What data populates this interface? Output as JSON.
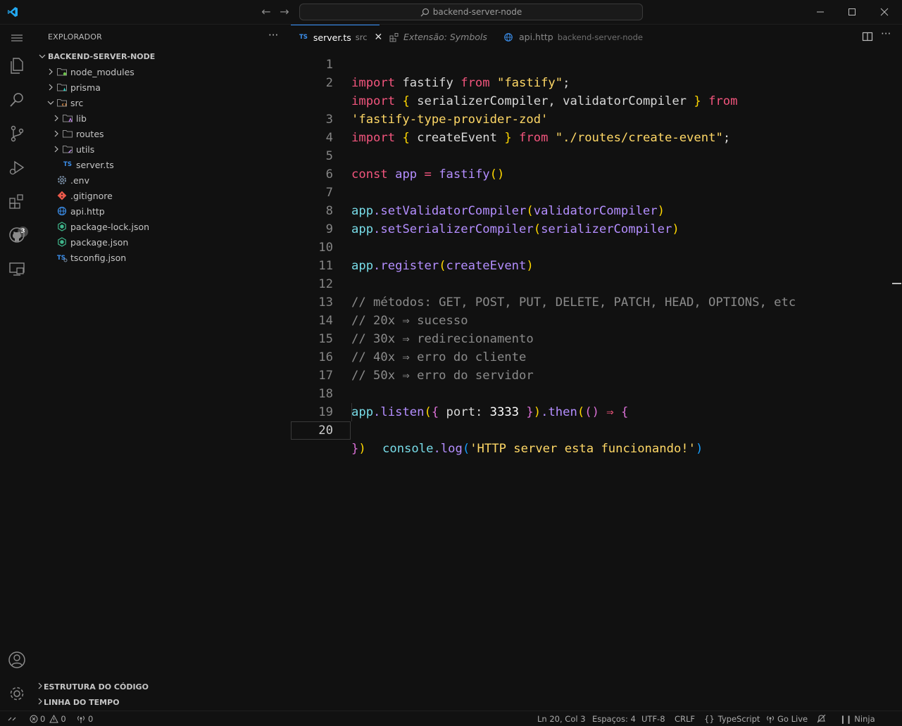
{
  "titlebar": {
    "search_text": "backend-server-node"
  },
  "activitybar": {
    "extensions_badge": "3"
  },
  "sidebar": {
    "title": "EXPLORADOR",
    "more": "···",
    "root": "BACKEND-SERVER-NODE",
    "items": [
      {
        "label": "node_modules"
      },
      {
        "label": "prisma"
      },
      {
        "label": "src"
      },
      {
        "label": "lib"
      },
      {
        "label": "routes"
      },
      {
        "label": "utils"
      },
      {
        "label": "server.ts"
      },
      {
        "label": ".env"
      },
      {
        "label": ".gitignore"
      },
      {
        "label": "api.http"
      },
      {
        "label": "package-lock.json"
      },
      {
        "label": "package.json"
      },
      {
        "label": "tsconfig.json"
      }
    ],
    "outline": "ESTRUTURA DO CÓDIGO",
    "timeline": "LINHA DO TEMPO"
  },
  "tabs": [
    {
      "badge": "TS",
      "label": "server.ts",
      "desc": "src",
      "close": "✕"
    },
    {
      "label": "Extensão: Symbols"
    },
    {
      "label": "api.http",
      "desc": "backend-server-node"
    }
  ],
  "code": {
    "line_numbers": [
      "1",
      "2",
      "",
      "3",
      "4",
      "5",
      "6",
      "7",
      "8",
      "9",
      "10",
      "11",
      "12",
      "13",
      "14",
      "15",
      "16",
      "17",
      "18",
      "19",
      "20"
    ],
    "l1": {
      "a": "import",
      "b": " fastify ",
      "c": "from",
      "d": " \"fastify\"",
      "e": ";"
    },
    "l2": {
      "a": "import",
      "b": "{",
      "c": " serializerCompiler, validatorCompiler ",
      "d": "}",
      "e": " from"
    },
    "l2b": {
      "a": "'fastify-type-provider-zod'"
    },
    "l3": {
      "a": "import",
      "b": "{",
      "c": " createEvent ",
      "d": "}",
      "e": " from",
      "f": " \"./routes/create-event\"",
      "g": ";"
    },
    "l5": {
      "a": "const",
      "b": " app ",
      "c": "=",
      "d": " fastify",
      "e": "()"
    },
    "l7": {
      "a": "app",
      "b": ".setValidatorCompiler",
      "c": "(",
      "d": "validatorCompiler",
      "e": ")"
    },
    "l8": {
      "a": "app",
      "b": ".setSerializerCompiler",
      "c": "(",
      "d": "serializerCompiler",
      "e": ")"
    },
    "l10": {
      "a": "app",
      "b": ".register",
      "c": "(",
      "d": "createEvent",
      "e": ")"
    },
    "l12": "// métodos: GET, POST, PUT, DELETE, PATCH, HEAD, OPTIONS, etc",
    "l13": "// 20x ⇒ sucesso",
    "l14": "// 30x ⇒ redirecionamento",
    "l15": "// 40x ⇒ erro do cliente",
    "l16": "// 50x ⇒ erro do servidor",
    "l18": {
      "a": "app",
      "b": ".listen",
      "c": "(",
      "d": "{",
      "e": " port: ",
      "f": "3333",
      "g": " }",
      "h": ")",
      "i": ".then",
      "j": "(",
      "k": "()",
      "l": " ⇒ ",
      "m": "{"
    },
    "l19": {
      "a": "console",
      "b": ".log",
      "c": "(",
      "d": "'HTTP server esta funcionando!'",
      "e": ")"
    },
    "l20": {
      "a": "}",
      "b": ")"
    }
  },
  "statusbar": {
    "errors": "0",
    "warnings": "0",
    "ports": "0",
    "position": "Ln 20, Col 3",
    "spaces": "Espaços: 4",
    "encoding": "UTF-8",
    "eol": "CRLF",
    "language": "TypeScript",
    "golive": "Go Live",
    "ninja": "Ninja"
  },
  "colors": {
    "background": "#111111",
    "keyword": "#f2557d",
    "string": "#ffd866",
    "function": "#b48eff",
    "identifier": "#78dce8",
    "comment": "#8b8b8b",
    "accent": "#3794ff"
  }
}
